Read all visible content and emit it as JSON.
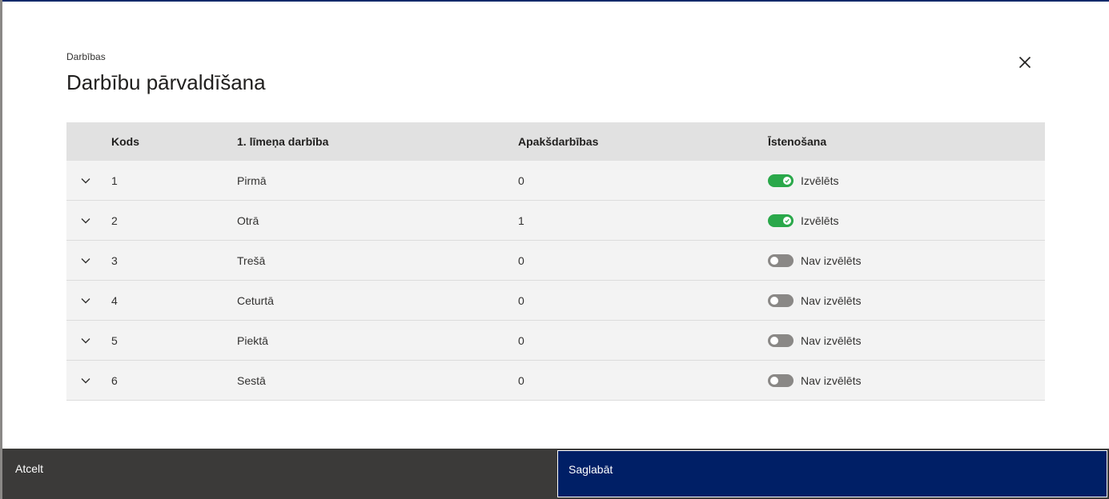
{
  "breadcrumb": "Darbības",
  "title": "Darbību pārvaldīšana",
  "close_icon": "close-icon",
  "grid": {
    "columns": {
      "code": "Kods",
      "name": "1. līmeņa darbība",
      "sub": "Apakšdarbības",
      "impl": "Īstenošana"
    },
    "rows": [
      {
        "code": "1",
        "name": "Pirmā",
        "sub": "0",
        "selected": true,
        "status": "Izvēlēts"
      },
      {
        "code": "2",
        "name": "Otrā",
        "sub": "1",
        "selected": true,
        "status": "Izvēlēts"
      },
      {
        "code": "3",
        "name": "Trešā",
        "sub": "0",
        "selected": false,
        "status": "Nav izvēlēts"
      },
      {
        "code": "4",
        "name": "Ceturtā",
        "sub": "0",
        "selected": false,
        "status": "Nav izvēlēts"
      },
      {
        "code": "5",
        "name": "Piektā",
        "sub": "0",
        "selected": false,
        "status": "Nav izvēlēts"
      },
      {
        "code": "6",
        "name": "Sestā",
        "sub": "0",
        "selected": false,
        "status": "Nav izvēlēts"
      }
    ]
  },
  "footer": {
    "cancel_label": "Atcelt",
    "save_label": "Saglabāt"
  },
  "colors": {
    "toggle_on": "#2aa84a",
    "toggle_off": "#8a8886",
    "save_bg": "#001f66",
    "footer_bg": "#3b3a39"
  }
}
